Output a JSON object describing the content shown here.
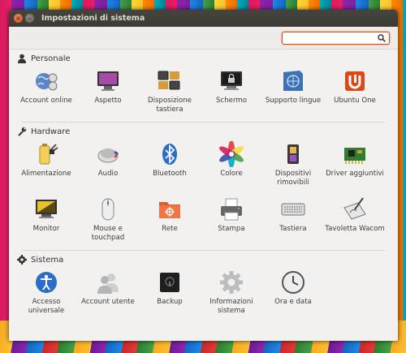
{
  "window": {
    "title": "Impostazioni di sistema"
  },
  "search": {
    "value": "",
    "placeholder": ""
  },
  "sections": [
    {
      "title": "Personale",
      "items": [
        {
          "label": "Account online",
          "icon": "online-accounts-icon"
        },
        {
          "label": "Aspetto",
          "icon": "appearance-icon"
        },
        {
          "label": "Disposizione tastiera",
          "icon": "keyboard-layout-icon"
        },
        {
          "label": "Schermo",
          "icon": "lock-screen-icon"
        },
        {
          "label": "Supporto lingue",
          "icon": "language-support-icon"
        },
        {
          "label": "Ubuntu One",
          "icon": "ubuntu-one-icon"
        }
      ]
    },
    {
      "title": "Hardware",
      "items": [
        {
          "label": "Alimentazione",
          "icon": "power-icon"
        },
        {
          "label": "Audio",
          "icon": "sound-icon"
        },
        {
          "label": "Bluetooth",
          "icon": "bluetooth-icon"
        },
        {
          "label": "Colore",
          "icon": "color-icon"
        },
        {
          "label": "Dispositivi rimovibili",
          "icon": "removable-devices-icon"
        },
        {
          "label": "Driver aggiuntivi",
          "icon": "additional-drivers-icon"
        },
        {
          "label": "Monitor",
          "icon": "monitor-icon"
        },
        {
          "label": "Mouse e touchpad",
          "icon": "mouse-icon"
        },
        {
          "label": "Rete",
          "icon": "network-icon"
        },
        {
          "label": "Stampa",
          "icon": "printer-icon"
        },
        {
          "label": "Tastiera",
          "icon": "keyboard-icon"
        },
        {
          "label": "Tavoletta Wacom",
          "icon": "wacom-tablet-icon"
        }
      ]
    },
    {
      "title": "Sistema",
      "items": [
        {
          "label": "Accesso universale",
          "icon": "universal-access-icon"
        },
        {
          "label": "Account utente",
          "icon": "user-accounts-icon"
        },
        {
          "label": "Backup",
          "icon": "backup-icon"
        },
        {
          "label": "Informazioni sistema",
          "icon": "system-info-icon"
        },
        {
          "label": "Ora e data",
          "icon": "clock-icon"
        }
      ]
    }
  ]
}
